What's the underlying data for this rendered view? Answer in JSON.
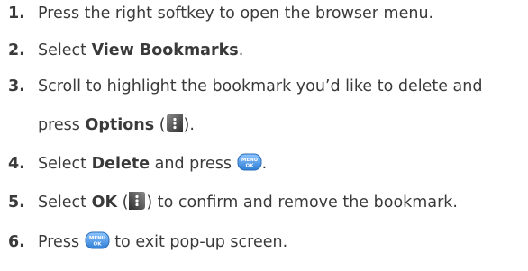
{
  "steps": [
    {
      "number": "1.",
      "text": "Press the right softkey to open the browser menu."
    },
    {
      "number": "2.",
      "pre": "Select ",
      "bold": "View Bookmarks",
      "post": "."
    },
    {
      "number": "3.",
      "line1": "Scroll to highlight the bookmark you’d like to delete and",
      "pre": "press ",
      "bold": "Options",
      "open": " (",
      "close": ")."
    },
    {
      "number": "4.",
      "pre": "Select ",
      "bold": "Delete",
      "mid": " and press ",
      "post": "."
    },
    {
      "number": "5.",
      "pre": "Select ",
      "bold": "OK",
      "open": " (",
      "post": ") to confirm and remove the bookmark."
    },
    {
      "number": "6.",
      "pre": "Press ",
      "post": " to exit pop-up screen."
    }
  ],
  "icons": {
    "menu_ok_top": "MENU",
    "menu_ok_bottom": "OK",
    "softkey": "softkey-icon",
    "menu_ok": "menu-ok-key-icon",
    "colors": {
      "key_blue": "#3f8fe0",
      "key_dark": "#444444"
    }
  }
}
